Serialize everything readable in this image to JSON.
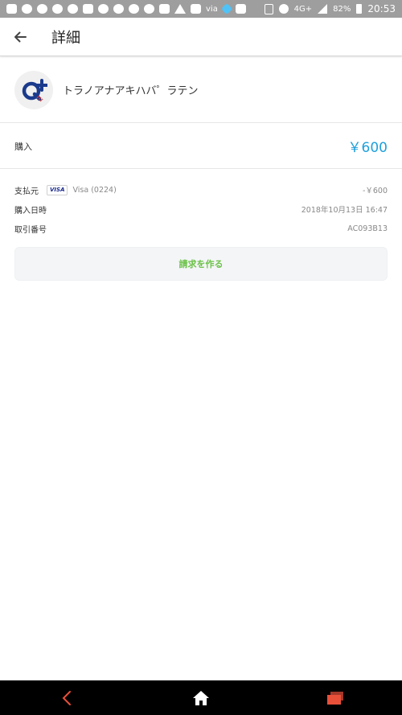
{
  "status_bar": {
    "carrier_text": "via",
    "network": "4G+",
    "battery": "82%",
    "time": "20:53"
  },
  "app_bar": {
    "title": "詳細",
    "back_icon": "arrow-left-icon"
  },
  "merchant": {
    "name": "トラノアナアキハバ゜ラテン",
    "logo_icon": "q-plus-logo"
  },
  "purchase": {
    "label": "購入",
    "amount": "￥600"
  },
  "details": {
    "payment_source": {
      "label": "支払元",
      "card_brand": "VISA",
      "card_text": "Visa (0224)",
      "value": "-￥600"
    },
    "purchase_datetime": {
      "label": "購入日時",
      "value": "2018年10月13日 16:47"
    },
    "transaction_number": {
      "label": "取引番号",
      "value": "AC093B13"
    }
  },
  "invoice_button": {
    "label": "請求を作る"
  },
  "colors": {
    "accent_blue": "#1ea0dc",
    "accent_green": "#6cc24a",
    "nav_back": "#e8503a",
    "nav_recents": "#e8503a"
  }
}
